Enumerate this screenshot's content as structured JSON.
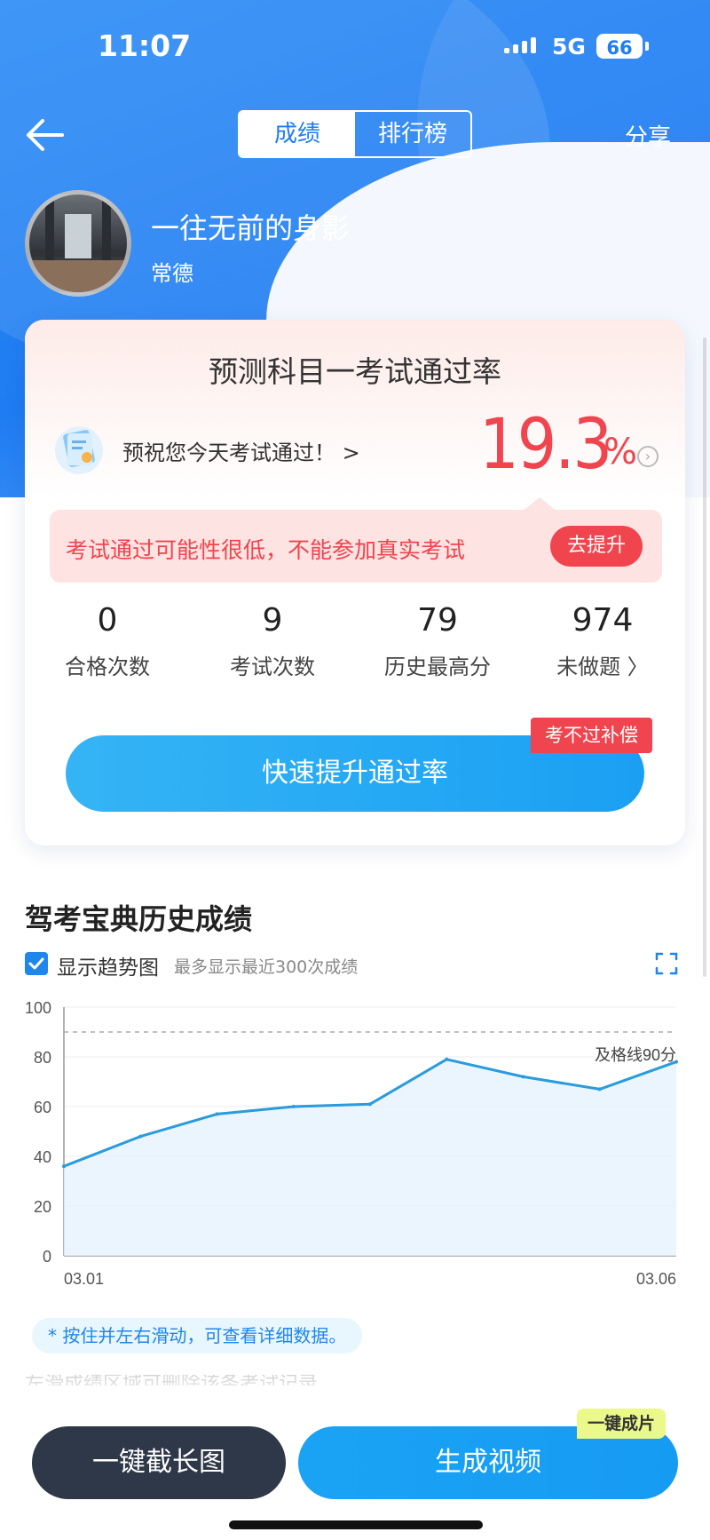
{
  "status_bar": {
    "time": "11:07",
    "network": "5G",
    "battery": "66"
  },
  "nav": {
    "tabs": [
      {
        "label": "成绩",
        "active": true
      },
      {
        "label": "排行榜",
        "active": false
      }
    ],
    "share_label": "分享"
  },
  "profile": {
    "name": "一往无前的身影",
    "city": "常德"
  },
  "prediction": {
    "title": "预测科目一考试通过率",
    "wish_text": "预祝您今天考试通过！ >",
    "rate": "19.3",
    "rate_unit": "%",
    "warning": "考试通过可能性很低，不能参加真实考试",
    "improve_button": "去提升",
    "stats": [
      {
        "value": "0",
        "label": "合格次数"
      },
      {
        "value": "9",
        "label": "考试次数"
      },
      {
        "value": "79",
        "label": "历史最高分"
      },
      {
        "value": "974",
        "label": "未做题 〉"
      }
    ],
    "cta_button": "快速提升通过率",
    "cta_tag": "考不过补偿"
  },
  "history": {
    "title": "驾考宝典历史成绩",
    "show_trend_label": "显示趋势图",
    "show_trend_checked": true,
    "trend_hint": "最多显示最近300次成绩",
    "slide_hint": "* 按住并左右滑动，可查看详细数据。"
  },
  "chart_data": {
    "type": "area",
    "y_ticks": [
      "100",
      "80",
      "60",
      "40",
      "20",
      "0"
    ],
    "x_tick_labels": [
      "03.01",
      "03.06"
    ],
    "ylim": [
      0,
      100
    ],
    "pass_line": {
      "value": 90,
      "label": "及格线90分"
    },
    "values": [
      36,
      48,
      57,
      60,
      61,
      79,
      72,
      67,
      78
    ],
    "colors": {
      "line": "#2a9bdc",
      "fill": "#e6f3fc",
      "pass_line": "#aaaaaa"
    }
  },
  "footer": {
    "screenshot_button": "一键截长图",
    "video_button": "生成视频",
    "video_tag": "一键成片"
  },
  "colors": {
    "brand_blue": "#1f7cf2",
    "accent_red": "#f0444e",
    "button_dark": "#2f3848"
  }
}
